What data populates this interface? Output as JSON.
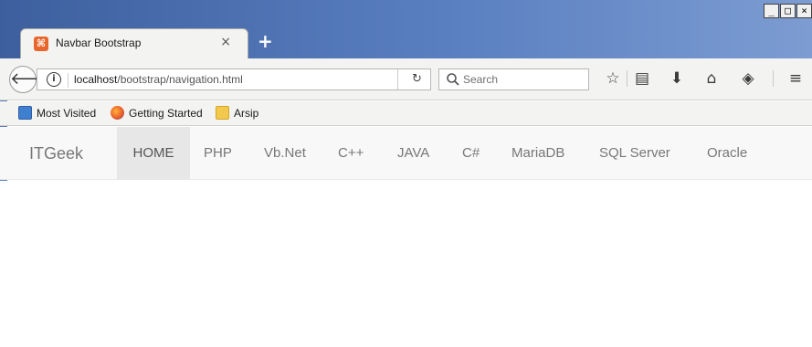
{
  "window": {
    "minimize": "_",
    "maximize": "□",
    "close": "×"
  },
  "tab": {
    "title": "Navbar Bootstrap",
    "close": "×",
    "new_tab": "+"
  },
  "toolbar": {
    "url_host": "localhost",
    "url_path": "/bootstrap/navigation.html",
    "search_placeholder": "Search"
  },
  "bookmarks": [
    {
      "label": "Most Visited",
      "icon": "most-visited-icon"
    },
    {
      "label": "Getting Started",
      "icon": "firefox-icon"
    },
    {
      "label": "Arsip",
      "icon": "folder-icon"
    }
  ],
  "navbar": {
    "brand": "ITGeek",
    "items": [
      {
        "label": "HOME",
        "active": true
      },
      {
        "label": "PHP"
      },
      {
        "label": "Vb.Net"
      },
      {
        "label": "C++"
      },
      {
        "label": "JAVA"
      },
      {
        "label": "C#"
      },
      {
        "label": "MariaDB"
      },
      {
        "label": "SQL Server"
      },
      {
        "label": "Oracle"
      }
    ]
  },
  "colors": {
    "titlebar": "#3d5f9e",
    "navbar_bg": "#f8f8f8",
    "nav_active_bg": "#e7e7e7",
    "nav_text": "#777777"
  }
}
